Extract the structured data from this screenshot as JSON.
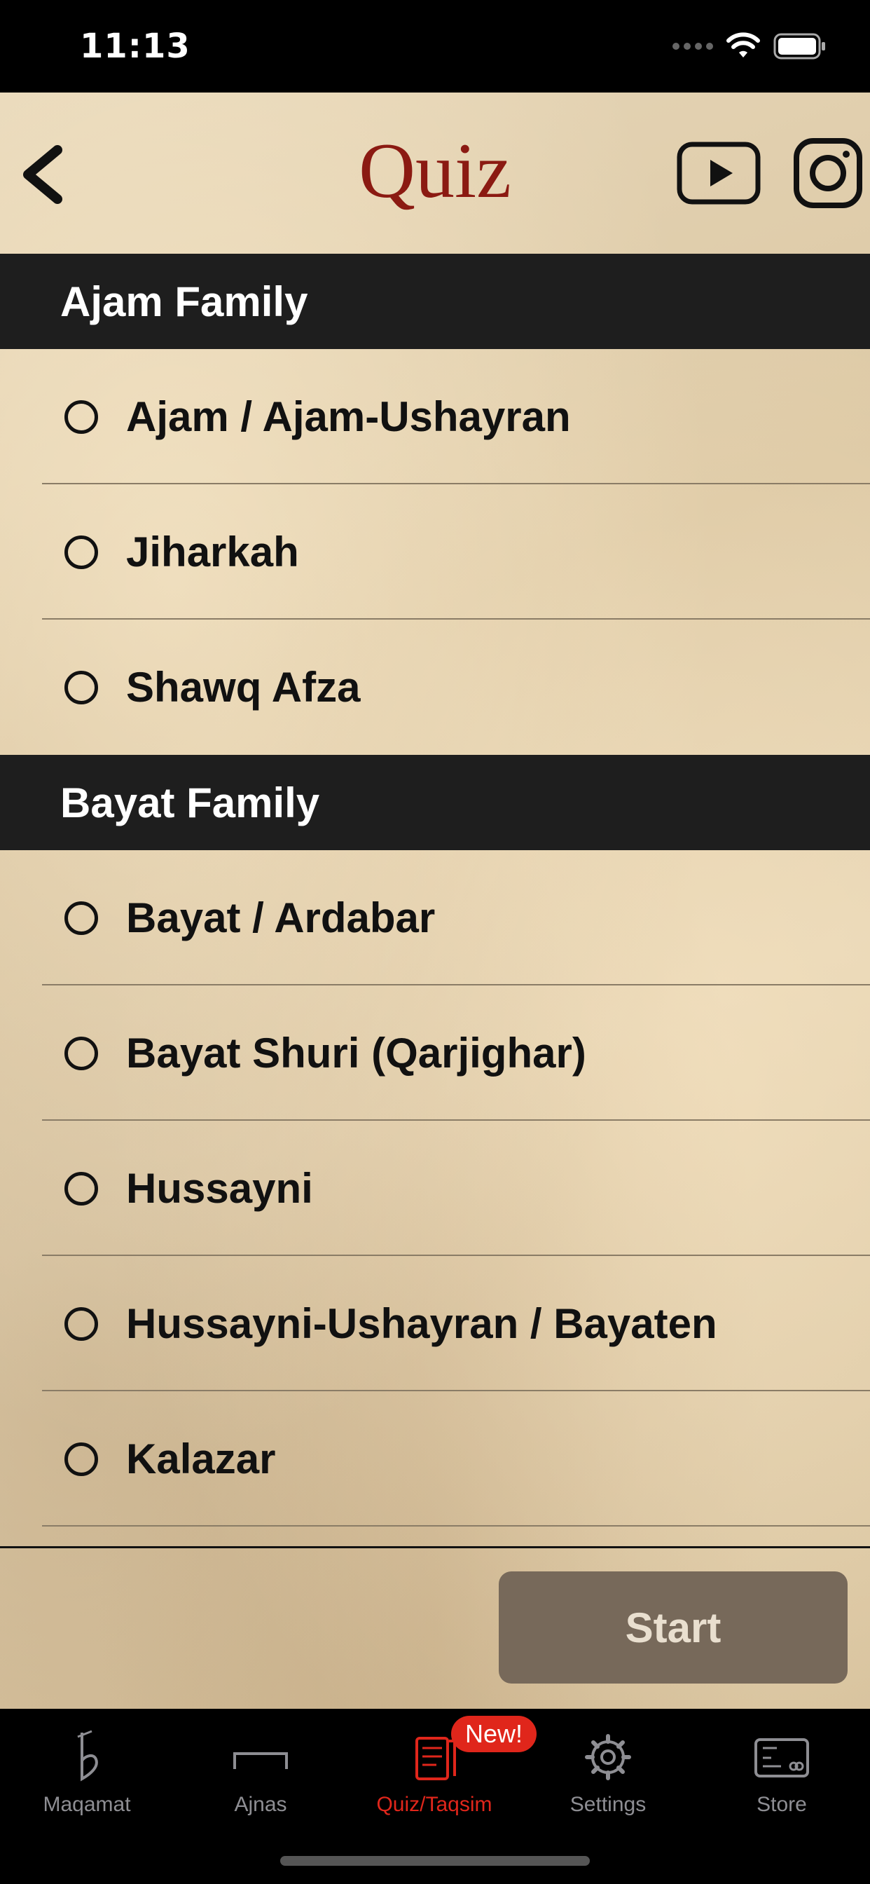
{
  "status_bar": {
    "time": "11:13"
  },
  "nav": {
    "title": "Quiz"
  },
  "sections": [
    {
      "title": "Ajam Family",
      "items": [
        "Ajam / Ajam-Ushayran",
        "Jiharkah",
        "Shawq Afza"
      ]
    },
    {
      "title": "Bayat Family",
      "items": [
        "Bayat / Ardabar",
        "Bayat Shuri (Qarjighar)",
        "Hussayni",
        "Hussayni-Ushayran / Bayaten",
        "Kalazar"
      ]
    }
  ],
  "start_button": {
    "label": "Start"
  },
  "tabs": [
    {
      "label": "Maqamat",
      "icon": "flat-sign-icon"
    },
    {
      "label": "Ajnas",
      "icon": "bracket-icon"
    },
    {
      "label": "Quiz/Taqsim",
      "icon": "quiz-document-icon",
      "active": true,
      "badge": "New!"
    },
    {
      "label": "Settings",
      "icon": "gear-icon"
    },
    {
      "label": "Store",
      "icon": "store-card-icon"
    }
  ],
  "colors": {
    "title_red": "#8b1a12",
    "active_tab": "#e0261b",
    "header_bg": "#1e1e1e",
    "start_bg": "#77695a"
  }
}
